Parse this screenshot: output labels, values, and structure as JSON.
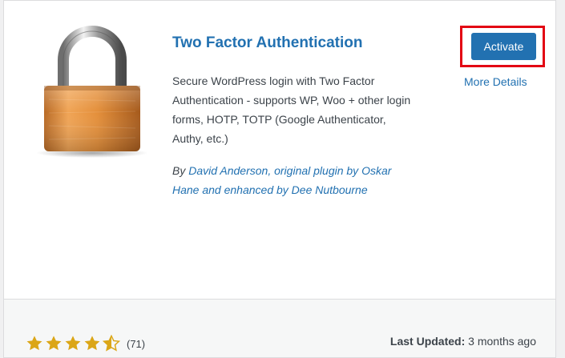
{
  "plugin": {
    "name": "Two Factor Authentication",
    "description": "Secure WordPress login with Two Factor Authentication - supports WP, Woo + other login forms, HOTP, TOTP (Google Authenticator, Authy, etc.)",
    "author_prefix": "By ",
    "author_links": "David Anderson, original plugin by Oskar Hane and enhanced by Dee Nutbourne",
    "icon": "padlock-icon"
  },
  "actions": {
    "activate_label": "Activate",
    "more_details_label": "More Details"
  },
  "footer": {
    "rating": 4.5,
    "rating_count": "(71)",
    "last_updated_label": "Last Updated:",
    "last_updated_value": "3 months ago"
  },
  "colors": {
    "link": "#2271b1",
    "button": "#2271b1",
    "highlight": "#e30613",
    "star": "#dba617"
  }
}
